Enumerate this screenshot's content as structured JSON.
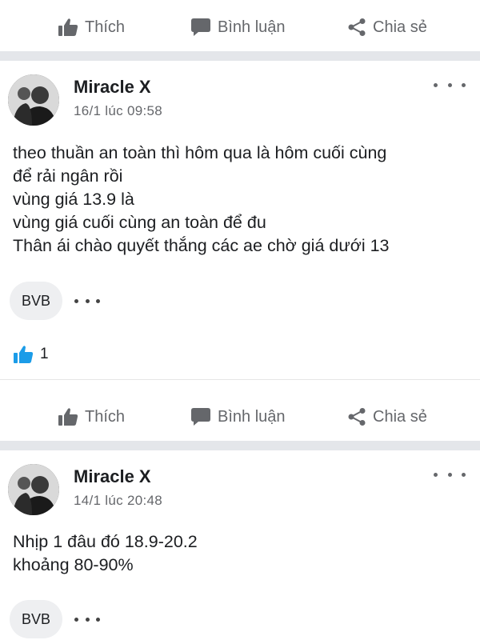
{
  "actions": {
    "like_label": "Thích",
    "comment_label": "Bình luận",
    "share_label": "Chia sẻ"
  },
  "posts": [
    {
      "author": "Miracle X",
      "timestamp": "16/1 lúc 09:58",
      "content": "theo thuần an toàn thì hôm qua là hôm cuối cùng\nđể rải ngân rồi\nvùng giá 13.9 là\nvùng giá cuối cùng an toàn để đu\nThân ái chào quyết thắng các ae chờ giá dưới 13",
      "tag": "BVB",
      "like_count": "1"
    },
    {
      "author": "Miracle X",
      "timestamp": "14/1 lúc 20:48",
      "content": "Nhịp 1 đâu đó 18.9-20.2\nkhoảng 80-90%",
      "tag": "BVB"
    }
  ],
  "colors": {
    "divider": "#e4e6ea",
    "action_text": "#65676b",
    "like_blue": "#1b9ce8",
    "tag_bg": "#eeeff1"
  },
  "icons": [
    "thumbs-up-icon",
    "comment-bubble-icon",
    "share-icon",
    "more-options-icon",
    "like-reaction-icon"
  ]
}
